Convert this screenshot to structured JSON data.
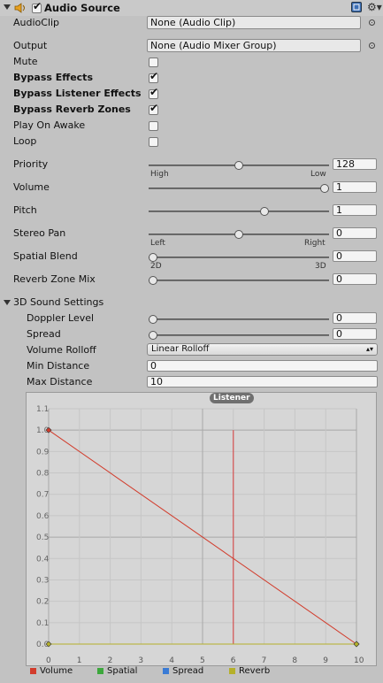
{
  "header": {
    "title": "Audio Source",
    "enabled": true,
    "speaker_icon": "speaker-icon",
    "help_icon": "help-icon",
    "gear_icon": "gear-icon"
  },
  "audio_clip": {
    "label": "AudioClip",
    "value": "None (Audio Clip)"
  },
  "output": {
    "label": "Output",
    "value": "None (Audio Mixer Group)"
  },
  "toggles": {
    "mute": {
      "label": "Mute",
      "checked": false
    },
    "bypass_effects": {
      "label": "Bypass Effects",
      "checked": true
    },
    "bypass_listener_effects": {
      "label": "Bypass Listener Effects",
      "checked": true
    },
    "bypass_reverb_zones": {
      "label": "Bypass Reverb Zones",
      "checked": true
    },
    "play_on_awake": {
      "label": "Play On Awake",
      "checked": false
    },
    "loop": {
      "label": "Loop",
      "checked": false
    }
  },
  "sliders": {
    "priority": {
      "label": "Priority",
      "value": "128",
      "fraction": 0.5,
      "min_label": "High",
      "max_label": "Low"
    },
    "volume": {
      "label": "Volume",
      "value": "1",
      "fraction": 1.0
    },
    "pitch": {
      "label": "Pitch",
      "value": "1",
      "fraction": 0.65
    },
    "stereo_pan": {
      "label": "Stereo Pan",
      "value": "0",
      "fraction": 0.5,
      "min_label": "Left",
      "max_label": "Right"
    },
    "spatial_blend": {
      "label": "Spatial Blend",
      "value": "0",
      "fraction": 0.0,
      "min_label": "2D",
      "max_label": "3D"
    },
    "reverb_zone_mix": {
      "label": "Reverb Zone Mix",
      "value": "0",
      "fraction": 0.0
    }
  },
  "sound_3d": {
    "title": "3D Sound Settings",
    "doppler_level": {
      "label": "Doppler Level",
      "value": "0",
      "fraction": 0.0
    },
    "spread": {
      "label": "Spread",
      "value": "0",
      "fraction": 0.0
    },
    "volume_rolloff": {
      "label": "Volume Rolloff",
      "value": "Linear Rolloff"
    },
    "min_distance": {
      "label": "Min Distance",
      "value": "0"
    },
    "max_distance": {
      "label": "Max Distance",
      "value": "10"
    }
  },
  "graph": {
    "listener_label": "Listener",
    "listener_x": 6,
    "y_ticks": [
      "0.0",
      "0.1",
      "0.2",
      "0.3",
      "0.4",
      "0.5",
      "0.6",
      "0.7",
      "0.8",
      "0.9",
      "1.0",
      "1.1"
    ],
    "x_ticks": [
      "0",
      "1",
      "2",
      "3",
      "4",
      "5",
      "6",
      "7",
      "8",
      "9",
      "10"
    ],
    "legend": [
      {
        "name": "Volume",
        "color": "#d23c2c"
      },
      {
        "name": "Spatial",
        "color": "#3ca83c"
      },
      {
        "name": "Spread",
        "color": "#3a7bd5"
      },
      {
        "name": "Reverb",
        "color": "#b5b02a"
      }
    ]
  },
  "chart_data": {
    "type": "line",
    "title": "",
    "xlabel": "",
    "ylabel": "",
    "xlim": [
      0,
      10
    ],
    "ylim": [
      0,
      1.1
    ],
    "series": [
      {
        "name": "Volume",
        "color": "#d23c2c",
        "x": [
          0,
          10
        ],
        "y": [
          1.0,
          0.0
        ]
      },
      {
        "name": "Reverb",
        "color": "#b5b02a",
        "x": [
          0,
          10
        ],
        "y": [
          0.0,
          0.0
        ]
      }
    ]
  }
}
